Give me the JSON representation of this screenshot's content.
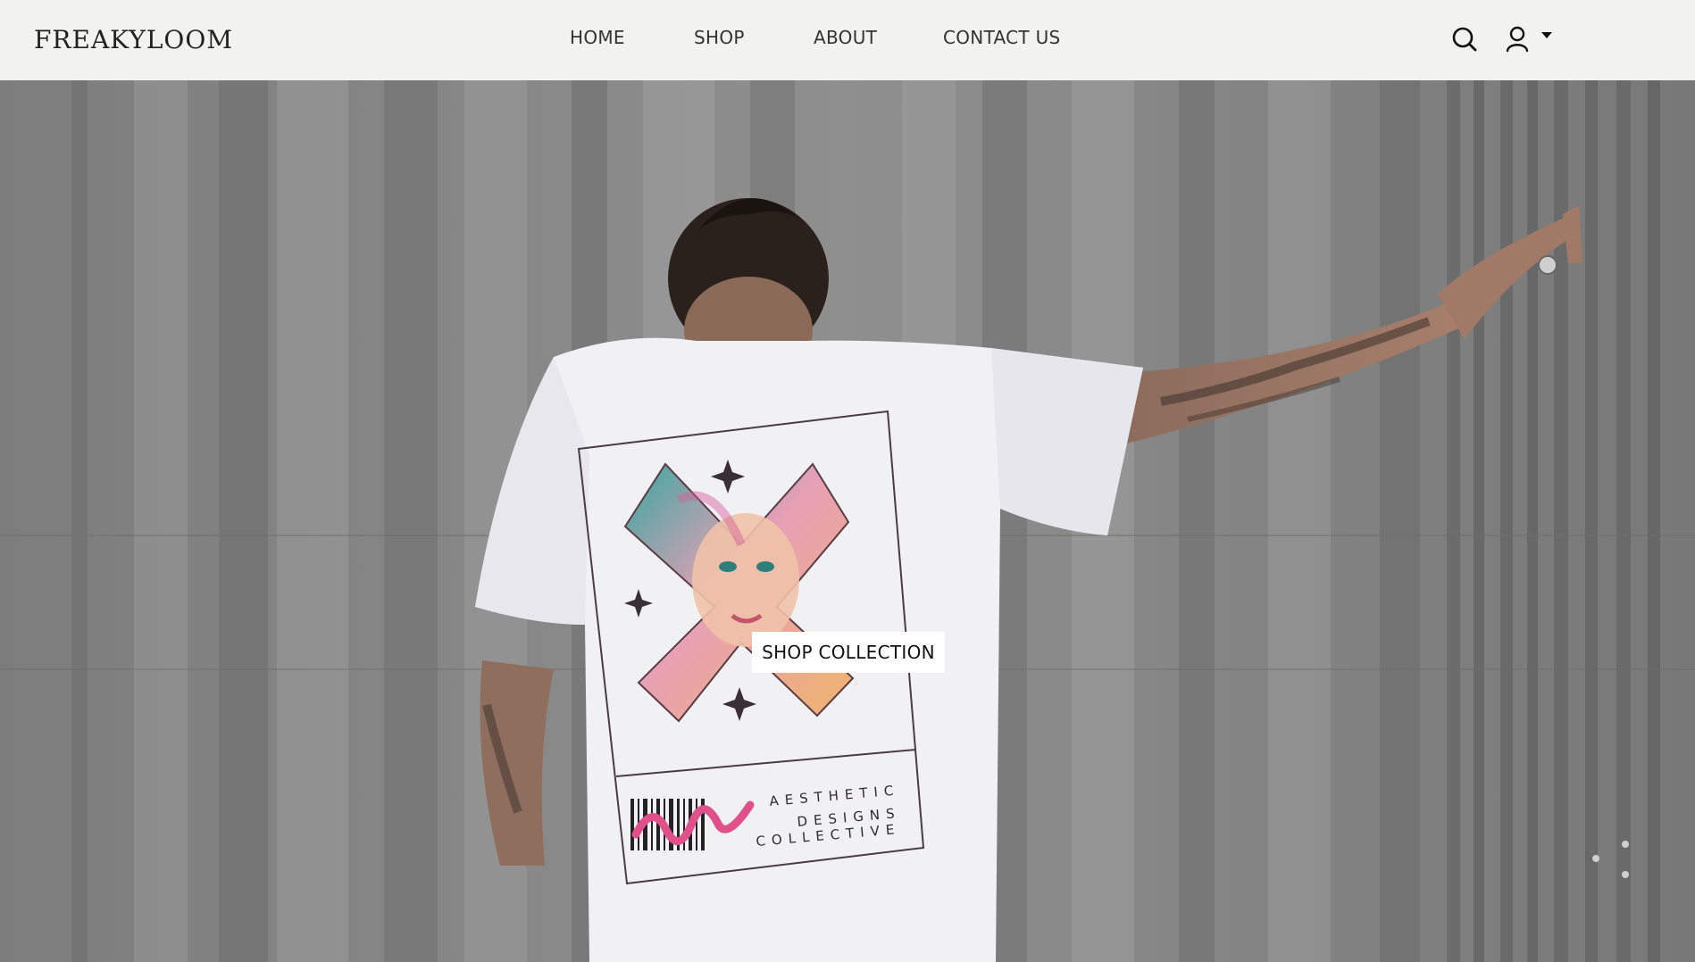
{
  "header": {
    "logo": "FREAKYLOOM",
    "nav": [
      {
        "label": "HOME"
      },
      {
        "label": "SHOP"
      },
      {
        "label": "ABOUT"
      },
      {
        "label": "CONTACT US"
      }
    ],
    "icons": {
      "search": "search-icon",
      "account": "user-icon",
      "dropdown": "caret-down-icon"
    }
  },
  "hero": {
    "cta_label": "SHOP COLLECTION",
    "shirt_print_text": [
      "AESTHETIC",
      "DESIGNS",
      "COLLECTIVE"
    ]
  },
  "colors": {
    "header_bg": "#f2f2f0",
    "wall": "#8a8a8a",
    "shirt": "#f1f1f4",
    "accent_teal": "#3aa7a0",
    "accent_pink": "#e0508a"
  }
}
